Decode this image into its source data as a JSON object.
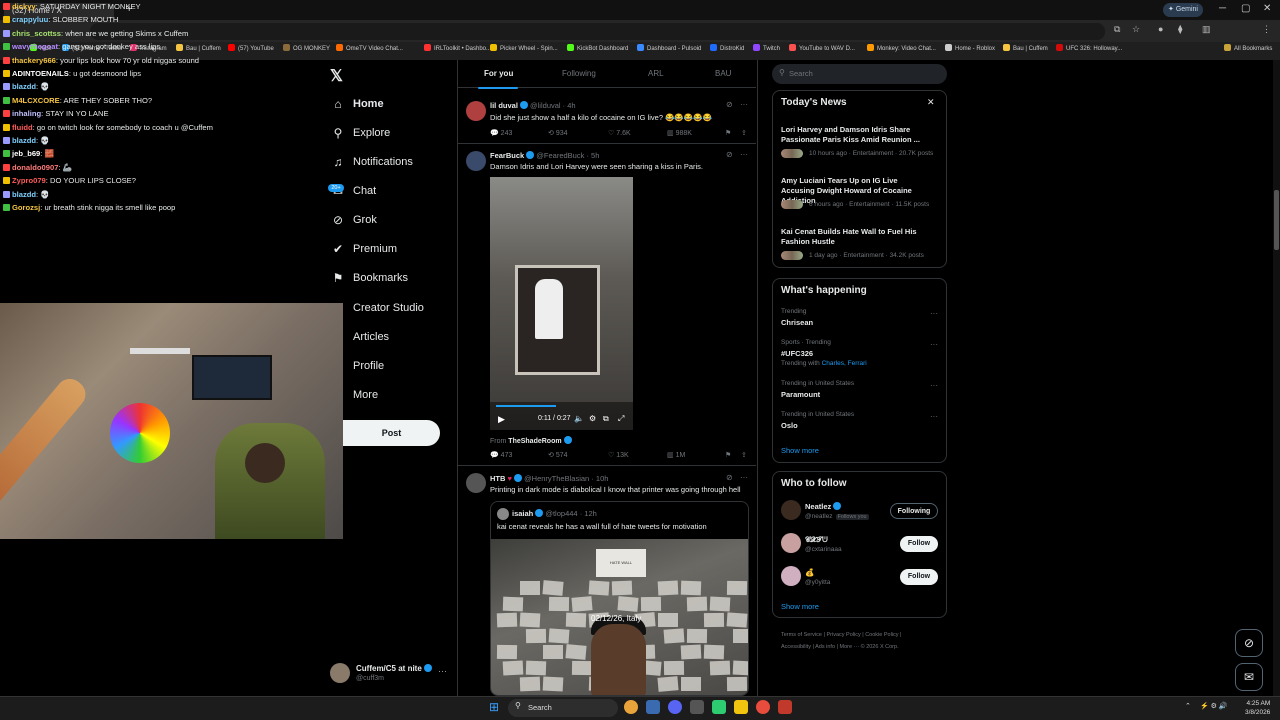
{
  "browser": {
    "tab_title": "(32) Home / X",
    "gemini_label": "Gemini",
    "bookmarks": [
      "Kick",
      "(32) Home / Twitter",
      "Instagram",
      "Bau | Cuffem",
      "(57) YouTube",
      "OG MONKEY",
      "OmeTV Video Chat...",
      "IRLToolkit • Dashbo...",
      "Picker Wheel - Spin...",
      "KickBot Dashboard",
      "Dashboard - Pulsoid",
      "DistroKid",
      "Twitch",
      "YouTube to WAV D...",
      "Monkey: Video Chat...",
      "Home - Roblox",
      "Bau | Cuffem",
      "UFC 326: Holloway..."
    ],
    "all_bookmarks": "All Bookmarks"
  },
  "chat": [
    {
      "user": "dickyy",
      "color": "#f5c542",
      "msg": "SATURDAY NIGHT MONKEY"
    },
    {
      "user": "crappyluu",
      "color": "#7fd1ff",
      "msg": "SLOBBER MOUTH"
    },
    {
      "user": "chris_scottss",
      "color": "#a6e36e",
      "msg": "when are we getting Skims x Cuffem"
    },
    {
      "user": "wavythegoat",
      "color": "#b48cff",
      "msg": "gang you got donkey ass lips"
    },
    {
      "user": "thackery666",
      "color": "#f5c542",
      "msg": "your lips look how 70 yr old niggas sound"
    },
    {
      "user": "ADINTOENAILS",
      "color": "#ffffff",
      "msg": "u got desmoond lips"
    },
    {
      "user": "blazdd",
      "color": "#7fd1ff",
      "msg": "💀"
    },
    {
      "user": "M4LCXCORE",
      "color": "#f5c542",
      "msg": "ARE THEY SOBER THO?"
    },
    {
      "user": "inhaling",
      "color": "#c0c0ff",
      "msg": "STAY IN YO LANE"
    },
    {
      "user": "fluidd",
      "color": "#ff5a5a",
      "msg": "go on twitch look for somebody to coach u @Cuffem"
    },
    {
      "user": "blazdd",
      "color": "#7fd1ff",
      "msg": "💀"
    },
    {
      "user": "jeb_b69",
      "color": "#ffffff",
      "msg": "🧱"
    },
    {
      "user": "donaldo0907",
      "color": "#ff7a7a",
      "msg": "🦾"
    },
    {
      "user": "Zypro079",
      "color": "#ff5a5a",
      "msg": "DO YOUR LIPS CLOSE?"
    },
    {
      "user": "blazdd",
      "color": "#7fd1ff",
      "msg": "💀"
    },
    {
      "user": "Gorozsj",
      "color": "#f5c542",
      "msg": "ur breath stink nigga its smell like poop"
    }
  ],
  "nav": {
    "items": [
      {
        "label": "Home",
        "icon": "home-icon",
        "glyph": "⌂"
      },
      {
        "label": "Explore",
        "icon": "search-icon",
        "glyph": "⚲"
      },
      {
        "label": "Notifications",
        "icon": "bell-icon",
        "glyph": "♫"
      },
      {
        "label": "Chat",
        "icon": "chat-icon",
        "glyph": "✉"
      },
      {
        "label": "Grok",
        "icon": "grok-icon",
        "glyph": "⊘"
      },
      {
        "label": "Premium",
        "icon": "premium-icon",
        "glyph": "✔"
      },
      {
        "label": "Bookmarks",
        "icon": "bookmark-icon",
        "glyph": "⚑"
      },
      {
        "label": "Creator Studio",
        "icon": "",
        "glyph": ""
      },
      {
        "label": "Articles",
        "icon": "",
        "glyph": ""
      },
      {
        "label": "Profile",
        "icon": "",
        "glyph": ""
      },
      {
        "label": "More",
        "icon": "",
        "glyph": ""
      }
    ],
    "chat_badge": "20+",
    "post_label": "Post"
  },
  "account": {
    "name": "Cuffem/C5 at nite",
    "handle": "@cuff3m"
  },
  "feed_tabs": [
    "For you",
    "Following",
    "ARL",
    "BAU"
  ],
  "tweets": [
    {
      "name": "lil duval",
      "handle": "@lilduval",
      "time": "· 4h",
      "text": "Did she just show a half a kilo of cocaine on IG live? 😂😂😂😂😂",
      "replies": "243",
      "retweets": "934",
      "likes": "7.6K",
      "views": "988K"
    },
    {
      "name": "FearBuck",
      "handle": "@FearedBuck",
      "time": "· 5h",
      "text": "Damson Idris and Lori Harvey were seen sharing a kiss in Paris.",
      "video_time": "0:11 / 0:27",
      "from_label": "From",
      "from_source": "TheShadeRoom",
      "replies": "473",
      "retweets": "574",
      "likes": "13K",
      "views": "1M"
    },
    {
      "name": "HTB",
      "handle": "@HenryTheBlasian",
      "time": "· 10h",
      "text": "Printing in dark mode is diabolical I know that printer was going through hell",
      "quote": {
        "name": "isaiah",
        "handle": "@tlop444",
        "time": "· 12h",
        "text": "kai cenat reveals he has a wall full of hate tweets for motivation",
        "overlay": "02/12/26, Italy",
        "sign": "HATE WALL"
      }
    }
  ],
  "right": {
    "search_placeholder": "Search",
    "news_title": "Today's News",
    "news": [
      {
        "title": "Lori Harvey and Damson Idris Share Passionate Paris Kiss Amid Reunion ...",
        "meta": "10 hours ago · Entertainment · 20.7K posts"
      },
      {
        "title": "Amy Luciani Tears Up on IG Live Accusing Dwight Howard of Cocaine Addiction",
        "meta": "6 hours ago · Entertainment · 11.5K posts"
      },
      {
        "title": "Kai Cenat Builds Hate Wall to Fuel His Fashion Hustle",
        "meta": "1 day ago · Entertainment · 34.2K posts"
      }
    ],
    "happening_title": "What's happening",
    "trends": [
      {
        "context": "Trending",
        "name": "Chrisean",
        "extra": "",
        "extra_link": ""
      },
      {
        "context": "Sports · Trending",
        "name": "#UFC326",
        "extra": "Trending with",
        "extra_link": "Charles, Ferrari"
      },
      {
        "context": "Trending in United States",
        "name": "Paramount",
        "extra": "",
        "extra_link": ""
      },
      {
        "context": "Trending in United States",
        "name": "Oslo",
        "extra": "",
        "extra_link": ""
      }
    ],
    "show_more": "Show more",
    "who_title": "Who to follow",
    "follow": [
      {
        "name": "Neatlez",
        "handle": "@neatlez",
        "tag": "Follows you",
        "btn": "Following"
      },
      {
        "name": "𝓒𝓧𝓣ᕫ",
        "handle": "@cxtarinaaa",
        "tag": "",
        "btn": "Follow"
      },
      {
        "name": "💰",
        "handle": "@y0yitta",
        "tag": "",
        "btn": "Follow"
      }
    ],
    "footer": [
      "Terms of Service",
      "Privacy Policy",
      "Cookie Policy",
      "Accessibility",
      "Ads info",
      "More ···",
      "© 2026 X Corp."
    ]
  },
  "taskbar": {
    "search": "Search",
    "time": "4:25 AM",
    "date": "3/8/2026"
  }
}
